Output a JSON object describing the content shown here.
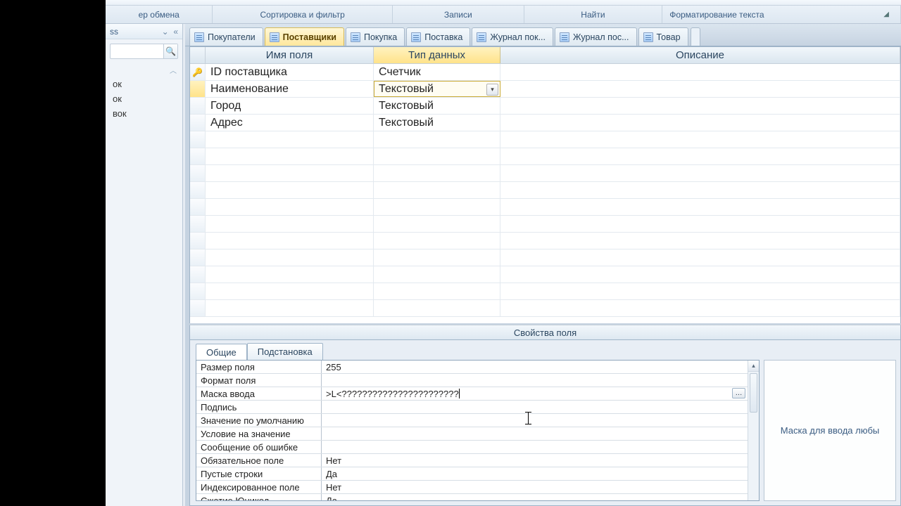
{
  "ribbon": {
    "groups": [
      "ер обмена",
      "Сортировка и фильтр",
      "Записи",
      "Найти",
      "Форматирование текста"
    ]
  },
  "nav": {
    "header_suffix": "ss",
    "items": [
      "ок",
      "ок",
      "вок"
    ]
  },
  "tabs": [
    {
      "label": "Покупатели",
      "active": false
    },
    {
      "label": "Поставщики",
      "active": true
    },
    {
      "label": "Покупка",
      "active": false
    },
    {
      "label": "Поставка",
      "active": false
    },
    {
      "label": "Журнал пок...",
      "active": false
    },
    {
      "label": "Журнал пос...",
      "active": false
    },
    {
      "label": "Товар",
      "active": false
    }
  ],
  "design": {
    "columns": {
      "name": "Имя поля",
      "type": "Тип данных",
      "desc": "Описание"
    },
    "rows": [
      {
        "pk": true,
        "selected": false,
        "name": "ID поставщика",
        "type": "Счетчик"
      },
      {
        "pk": false,
        "selected": true,
        "name": "Наименование",
        "type": "Текстовый"
      },
      {
        "pk": false,
        "selected": false,
        "name": "Город",
        "type": "Текстовый"
      },
      {
        "pk": false,
        "selected": false,
        "name": "Адрес",
        "type": "Текстовый"
      }
    ],
    "empty_rows": 11
  },
  "properties": {
    "caption": "Свойства поля",
    "tabs": {
      "general": "Общие",
      "lookup": "Подстановка"
    },
    "hint": "Маска для ввода любы",
    "rows": [
      {
        "label": "Размер поля",
        "value": "255"
      },
      {
        "label": "Формат поля",
        "value": ""
      },
      {
        "label": "Маска ввода",
        "value": ">L<???????????????????????",
        "editing": true,
        "builder": true
      },
      {
        "label": "Подпись",
        "value": ""
      },
      {
        "label": "Значение по умолчанию",
        "value": ""
      },
      {
        "label": "Условие на значение",
        "value": ""
      },
      {
        "label": "Сообщение об ошибке",
        "value": ""
      },
      {
        "label": "Обязательное поле",
        "value": "Нет"
      },
      {
        "label": "Пустые строки",
        "value": "Да"
      },
      {
        "label": "Индексированное поле",
        "value": "Нет"
      },
      {
        "label": "Сжатие Юникод",
        "value": "Да"
      }
    ]
  }
}
